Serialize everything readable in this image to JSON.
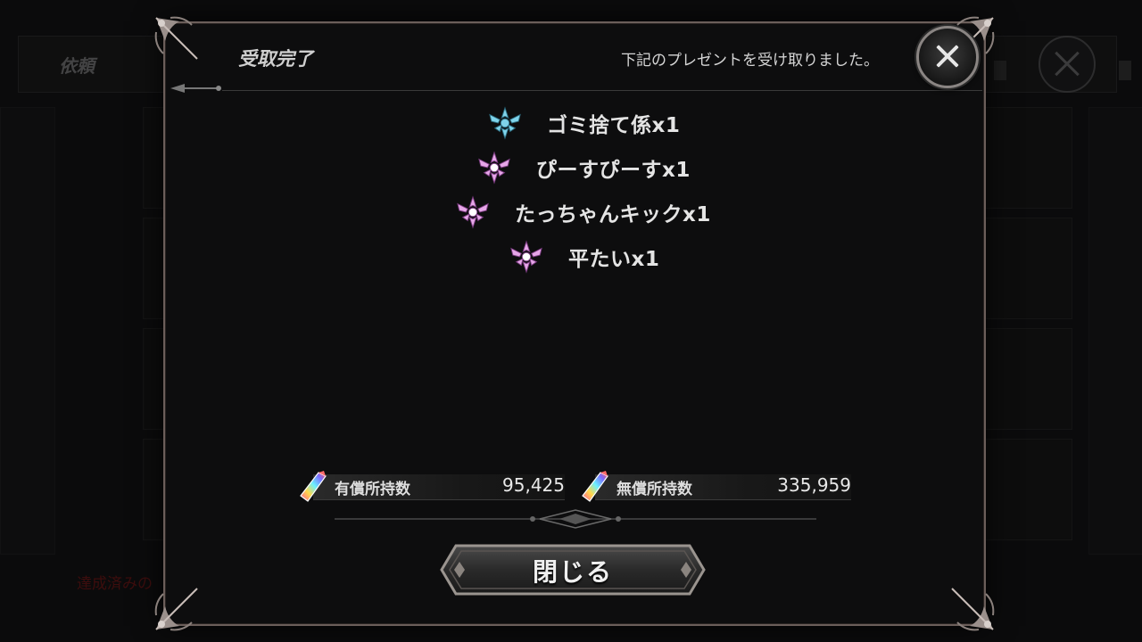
{
  "background": {
    "screen_title": "依頼",
    "footnote": "達成済みの"
  },
  "dialog": {
    "title": "受取完了",
    "message": "下記のプレゼントを受け取りました。",
    "close_icon": "close-icon",
    "items": [
      {
        "label": "ゴミ捨て係x1",
        "icon": "emblem-icon",
        "color": "#7fd3ea"
      },
      {
        "label": "ぴーすぴーすx1",
        "icon": "emblem-icon",
        "color": "#e6a6e8"
      },
      {
        "label": "たっちゃんキックx1",
        "icon": "emblem-icon",
        "color": "#e6a6e8"
      },
      {
        "label": "平たいx1",
        "icon": "emblem-icon",
        "color": "#e6a6e8"
      }
    ],
    "currency": {
      "paid": {
        "label": "有償所持数",
        "value": "95,425",
        "icon": "gem-icon"
      },
      "free": {
        "label": "無償所持数",
        "value": "335,959",
        "icon": "gem-icon"
      }
    },
    "close_button_label": "閉じる"
  },
  "colors": {
    "frame": "#6b5e5a",
    "background": "#0d0d0e",
    "accent_red": "#7a1010"
  }
}
